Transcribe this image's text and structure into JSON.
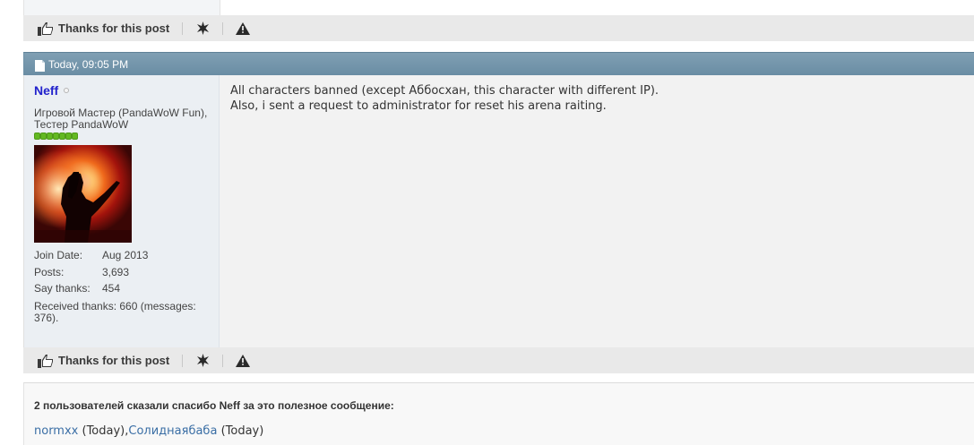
{
  "post_top": {
    "footer": {
      "thanks_label": "Thanks for this post"
    }
  },
  "post": {
    "date": "Today, 09:05 PM",
    "user": {
      "name": "Neff",
      "title": "Игровой Мастер (PandaWoW Fun), Тестер PandaWoW",
      "reputation_level": 7,
      "stats": [
        {
          "label": "Join Date:",
          "value": "Aug 2013"
        },
        {
          "label": "Posts:",
          "value": "3,693"
        },
        {
          "label": "Say thanks:",
          "value": "454"
        }
      ],
      "received_thanks": "Received thanks: 660 (messages: 376)."
    },
    "message_lines": [
      "All characters banned (except Аббосхан, this character with different IP).",
      "Also, i sent a request to administrator for reset his arena raiting."
    ],
    "footer": {
      "thanks_label": "Thanks for this post"
    }
  },
  "thanks": {
    "title": "2 пользователей сказали спасибо Neff за это полезное сообщение:",
    "users": [
      {
        "name": "normxx",
        "when": "(Today)"
      },
      {
        "name": "Солиднаябаба",
        "when": "(Today)"
      }
    ]
  },
  "icons": {
    "thanks": "thumbs-up-icon",
    "star": "star-burst-icon",
    "report": "warning-triangle-icon",
    "post_date": "document-icon"
  },
  "colors": {
    "post_header": "#7596ab",
    "username": "#2222cc",
    "reputation": "#63b821",
    "thanks_user_link": "#3a6ea5"
  }
}
